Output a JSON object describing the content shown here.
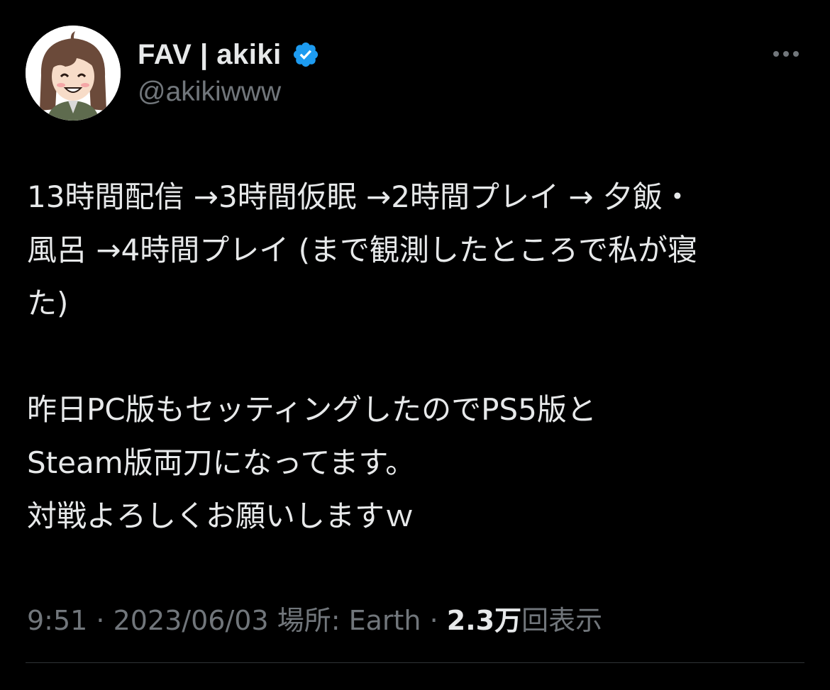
{
  "author": {
    "display_name": "FAV | akiki",
    "handle": "@akikiwww",
    "verified_icon": "verified-badge-icon",
    "verified_color": "#1d9bf0"
  },
  "menu": {
    "more_icon": "more-horizontal-icon"
  },
  "tweet": {
    "lines": [
      "13時間配信 →3時間仮眠 →2時間プレイ → 夕飯・",
      "風呂 →4時間プレイ (まで観測したところで私が寝",
      "た)",
      "",
      "昨日PC版もセッティングしたのでPS5版と",
      "Steam版両刀になってます。",
      "対戦よろしくお願いしますｗ"
    ]
  },
  "meta": {
    "time": "9:51",
    "separator": " · ",
    "date": "2023/06/03",
    "location": "場所: Earth",
    "views_count": "2.3万",
    "views_label": "回表示"
  },
  "colors": {
    "background": "#000000",
    "text_primary": "#e7e9ea",
    "text_secondary": "#71767b",
    "divider": "#2f3336"
  }
}
